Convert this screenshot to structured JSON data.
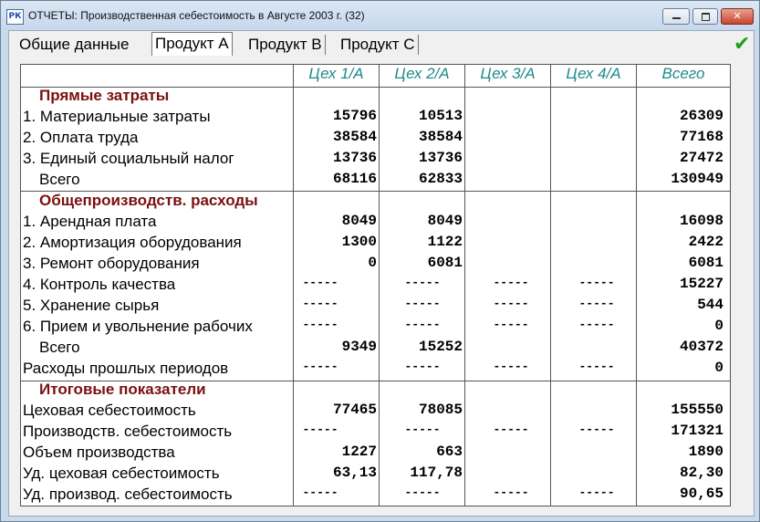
{
  "window": {
    "title": "ОТЧЕТЫ: Производственная себестоимость в Августе 2003 г. (32)",
    "icon_text": "РК"
  },
  "tabs": [
    {
      "label": "Общие данные",
      "active": false
    },
    {
      "label": "Продукт A",
      "active": true
    },
    {
      "label": "Продукт B",
      "active": false
    },
    {
      "label": "Продукт C",
      "active": false
    }
  ],
  "columns": [
    "Цех 1/А",
    "Цех 2/А",
    "Цех 3/А",
    "Цех 4/А",
    "Всего"
  ],
  "rows": [
    {
      "kind": "section",
      "label": "Прямые затраты"
    },
    {
      "kind": "item",
      "label": "1. Материальные затраты",
      "values": [
        "15796",
        "10513",
        "",
        "",
        "26309"
      ]
    },
    {
      "kind": "item",
      "label": "2. Оплата труда",
      "values": [
        "38584",
        "38584",
        "",
        "",
        "77168"
      ]
    },
    {
      "kind": "item",
      "label": "3. Единый социальный налог",
      "values": [
        "13736",
        "13736",
        "",
        "",
        "27472"
      ]
    },
    {
      "kind": "total",
      "label": "Всего",
      "values": [
        "68116",
        "62833",
        "",
        "",
        "130949"
      ]
    },
    {
      "kind": "section",
      "label": "Общепроизводств. расходы"
    },
    {
      "kind": "item",
      "label": "1. Арендная плата",
      "values": [
        "8049",
        "8049",
        "",
        "",
        "16098"
      ]
    },
    {
      "kind": "item",
      "label": "2. Амортизация оборудования",
      "values": [
        "1300",
        "1122",
        "",
        "",
        "2422"
      ]
    },
    {
      "kind": "item",
      "label": "3. Ремонт оборудования",
      "values": [
        "0",
        "6081",
        "",
        "",
        "6081"
      ]
    },
    {
      "kind": "item",
      "label": "4. Контроль качества",
      "values": [
        "-----",
        "-----",
        "-----",
        "-----",
        "15227"
      ]
    },
    {
      "kind": "item",
      "label": "5. Хранение сырья",
      "values": [
        "-----",
        "-----",
        "-----",
        "-----",
        "544"
      ]
    },
    {
      "kind": "item",
      "label": "6. Прием и увольнение рабочих",
      "values": [
        "-----",
        "-----",
        "-----",
        "-----",
        "0"
      ]
    },
    {
      "kind": "total",
      "label": "Всего",
      "values": [
        "9349",
        "15252",
        "",
        "",
        "40372"
      ]
    },
    {
      "kind": "item",
      "label": "Расходы прошлых периодов",
      "values": [
        "-----",
        "-----",
        "-----",
        "-----",
        "0"
      ]
    },
    {
      "kind": "section",
      "label": "Итоговые показатели"
    },
    {
      "kind": "item",
      "label": "Цеховая себестоимость",
      "values": [
        "77465",
        "78085",
        "",
        "",
        "155550"
      ]
    },
    {
      "kind": "item",
      "label": "Производств. себестоимость",
      "values": [
        "-----",
        "-----",
        "-----",
        "-----",
        "171321"
      ]
    },
    {
      "kind": "item",
      "label": "Объем производства",
      "values": [
        "1227",
        "663",
        "",
        "",
        "1890"
      ]
    },
    {
      "kind": "item",
      "label": "Уд. цеховая себестоимость",
      "values": [
        "63,13",
        "117,78",
        "",
        "",
        "82,30"
      ]
    },
    {
      "kind": "item",
      "label": "Уд. производ. себестоимость",
      "values": [
        "-----",
        "-----",
        "-----",
        "-----",
        "90,65"
      ]
    }
  ]
}
